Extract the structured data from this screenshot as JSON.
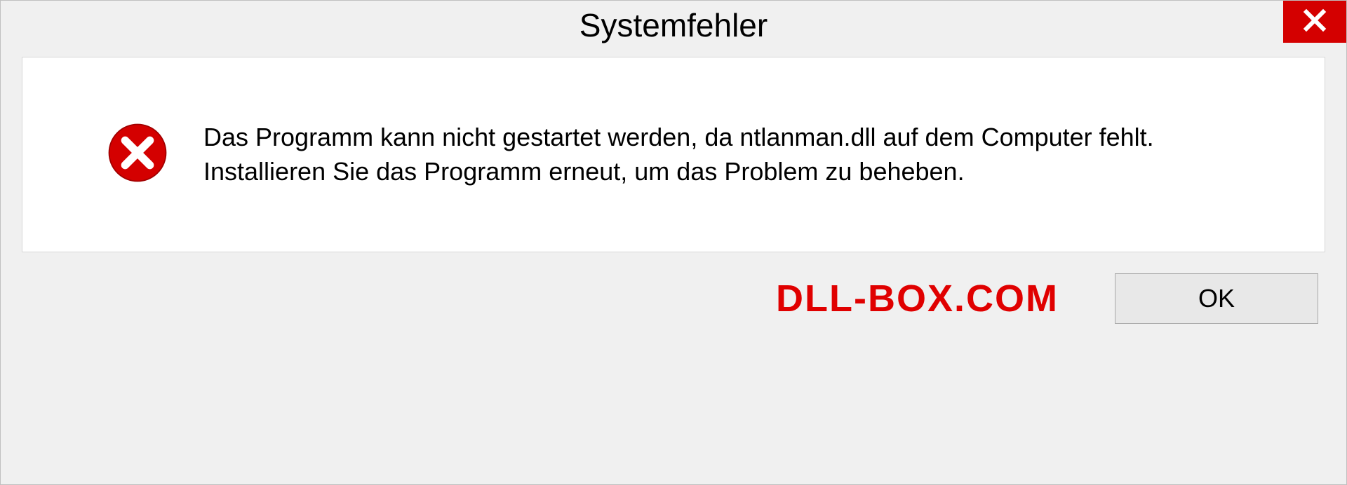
{
  "titlebar": {
    "title": "Systemfehler"
  },
  "message": {
    "text": "Das Programm kann nicht gestartet werden, da ntlanman.dll auf dem Computer fehlt. Installieren Sie das Programm erneut, um das Problem zu beheben."
  },
  "footer": {
    "watermark": "DLL-BOX.COM",
    "ok_label": "OK"
  },
  "colors": {
    "close_bg": "#d40000",
    "error_fill": "#d40000",
    "watermark_color": "#e00000"
  }
}
